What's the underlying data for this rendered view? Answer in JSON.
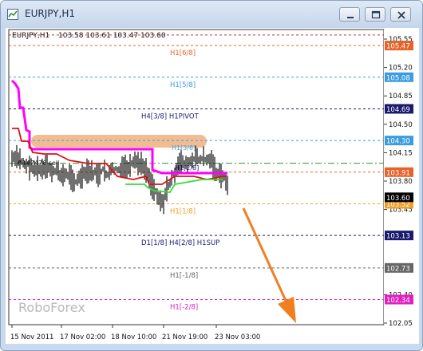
{
  "window": {
    "title": "EURJPY,H1",
    "buttons": {
      "minimize": "minimize",
      "restore": "restore",
      "close": "close"
    }
  },
  "chart_info": {
    "symbol": "EURJPY,H1",
    "ohlc": "103.58 103.61 103.47 103.60"
  },
  "watermark": "RoboForex",
  "murray_levels": [
    {
      "label": "",
      "price": 105.6,
      "price_label": "",
      "color": "#c0392b"
    },
    {
      "label": "H1[6/8]",
      "price": 105.47,
      "price_label": "105.47",
      "color": "#e8632b"
    },
    {
      "label": "H1[5/8]",
      "price": 105.08,
      "price_label": "105.08",
      "color": "#3b9de0"
    },
    {
      "label": "H4[3/8] H1PIVOT",
      "price": 104.69,
      "price_label": "104.69",
      "color": "#1a1a6e"
    },
    {
      "label": "",
      "price": 104.3,
      "price_label": "104.30",
      "color": "#3b9de0"
    },
    {
      "label": "",
      "price": 104.02,
      "price_label": "",
      "color": "#3a8f3a"
    },
    {
      "label": "",
      "price": 103.91,
      "price_label": "103.91",
      "color": "#e8632b"
    },
    {
      "label": "H1[1/8]",
      "price": 103.52,
      "price_label": "103.52",
      "color": "#f0a028"
    },
    {
      "label": "D1[1/8] H4[2/8] H1SUP",
      "price": 103.13,
      "price_label": "103.13",
      "color": "#1a1a6e"
    },
    {
      "label": "H1[-1/8]",
      "price": 102.73,
      "price_label": "102.73",
      "color": "#666666"
    },
    {
      "label": "H1[-2/8]",
      "price": 102.34,
      "price_label": "102.34",
      "color": "#e020c0"
    }
  ],
  "inline_labels": {
    "sell_label": "#147476 sell",
    "overlap_label": "H1[2/8]",
    "zone_label": "H1[3/8]"
  },
  "price_axis": {
    "ticks": [
      "105.55",
      "105.20",
      "104.85",
      "104.50",
      "104.15",
      "103.80",
      "103.45",
      "102.40",
      "102.05"
    ],
    "current_price": "103.60"
  },
  "time_axis": {
    "ticks": [
      "15 Nov 2011",
      "17 Nov 02:00",
      "18 Nov 10:00",
      "21 Nov 19:00",
      "23 Nov 03:00"
    ]
  },
  "colors": {
    "magenta_line": "#ff00ff",
    "red_line": "#dd1111",
    "green_line": "#33dd33",
    "highlight_zone": "#f0b080",
    "arrow": "#f07f20"
  }
}
